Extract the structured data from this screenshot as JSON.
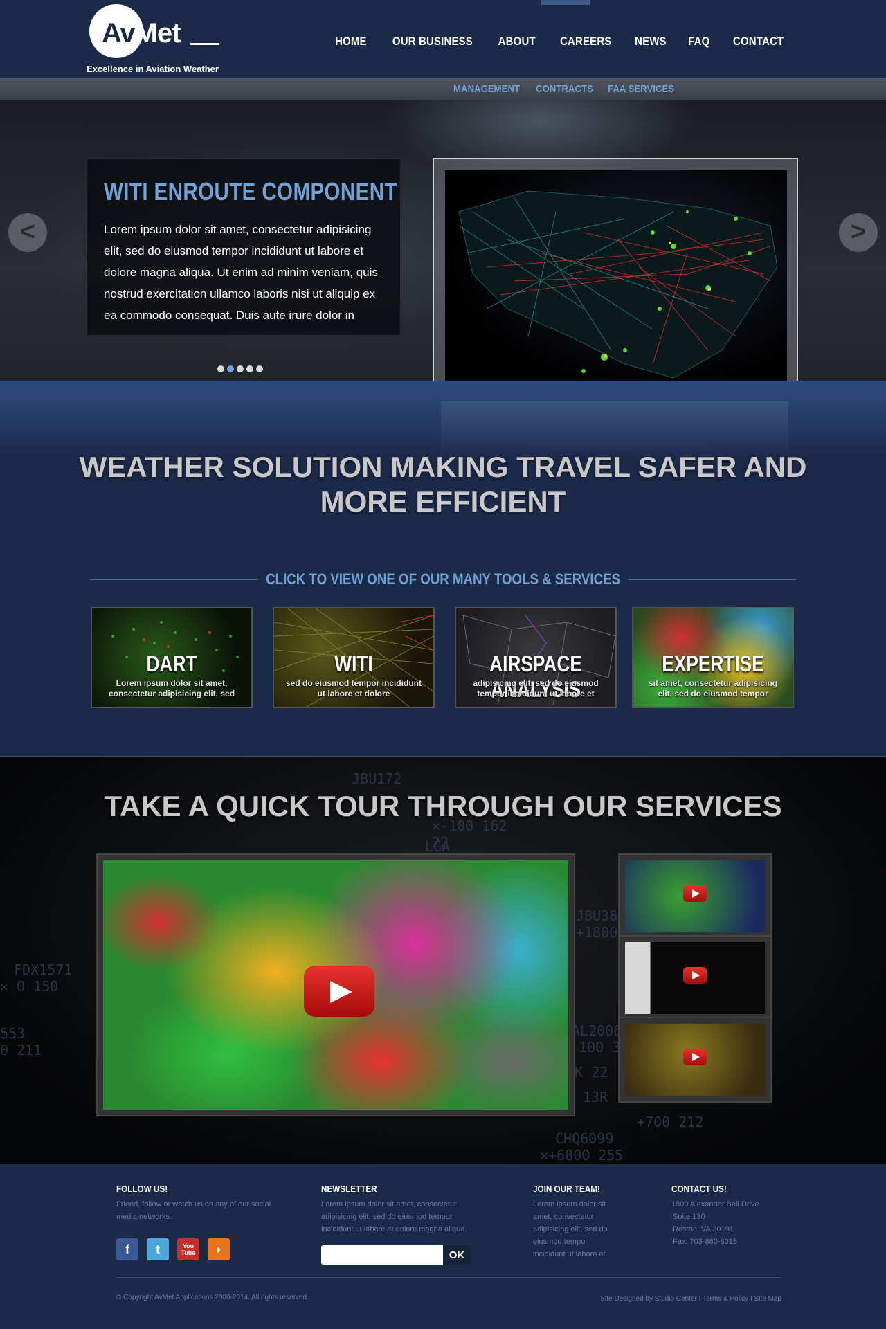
{
  "header": {
    "logo": {
      "brand_prefix": "Av",
      "brand_suffix": "Met",
      "tagline": "Excellence in Aviation Weather"
    },
    "nav": [
      {
        "label": "HOME"
      },
      {
        "label": "OUR BUSINESS"
      },
      {
        "label": "ABOUT"
      },
      {
        "label": "CAREERS"
      },
      {
        "label": "NEWS"
      },
      {
        "label": "FAQ"
      },
      {
        "label": "CONTACT"
      }
    ],
    "subnav": [
      {
        "label": "MANAGEMENT"
      },
      {
        "label": "CONTRACTS"
      },
      {
        "label": "FAA SERVICES"
      }
    ]
  },
  "hero": {
    "title": "WITI ENROUTE COMPONENT",
    "body": "Lorem ipsum dolor sit amet, consectetur adipisicing elit, sed do eiusmod tempor incididunt ut labore et dolore magna aliqua. Ut enim ad minim veniam, quis nostrud exercitation ullamco laboris nisi ut aliquip ex ea commodo consequat. Duis aute irure dolor in",
    "prev_label": "<",
    "next_label": ">",
    "slide_count": 5,
    "active_slide": 2
  },
  "headline": {
    "line1": "WEATHER SOLUTION MAKING TRAVEL SAFER AND",
    "line2": "MORE EFFICIENT"
  },
  "tools": {
    "heading": "CLICK TO VIEW ONE OF OUR MANY TOOLS & SERVICES",
    "items": [
      {
        "title": "DART",
        "desc": "Lorem ipsum dolor sit amet, consectetur adipisicing elit, sed"
      },
      {
        "title": "WITI",
        "desc": "sed do eiusmod tempor incididunt ut labore et dolore"
      },
      {
        "title": "AIRSPACE ANALYSIS",
        "desc": "adipisicing elit, sed do eiusmod tempor incididunt ut labore et"
      },
      {
        "title": "EXPERTISE",
        "desc": "sit amet, consectetur adipisicing elit, sed do eiusmod tempor"
      }
    ]
  },
  "tour": {
    "title": "TAKE A QUICK TOUR THROUGH OUR SERVICES",
    "bg_labels": [
      "JBU172",
      "✕-100 162",
      "22",
      "LGA",
      "FDX1571",
      "✕ 0 150",
      "553",
      "0 211",
      "JBU38",
      "+1800",
      "AL2006",
      "100 3",
      "13R",
      "CHQ6099",
      "✕+6800 255",
      "+700 212",
      "K 22"
    ]
  },
  "footer": {
    "follow": {
      "heading": "FOLLOW US!",
      "text": "Friend, follow or watch us on any of our social media networks."
    },
    "social": [
      {
        "name": "facebook",
        "glyph": "f",
        "color": "#3b5998"
      },
      {
        "name": "twitter",
        "glyph": "t",
        "color": "#4aa8dc"
      },
      {
        "name": "youtube",
        "glyph": "You Tube",
        "color": "#c4302b"
      },
      {
        "name": "rss",
        "glyph": "◗",
        "color": "#e8731b"
      }
    ],
    "newsletter": {
      "heading": "NEWSLETTER",
      "text": "Lorem ipsum dolor sit amet, consectetur adipisicing elit, sed do eiusmod tempor incididunt ut labore et dolore magna aliqua.",
      "placeholder": "",
      "button": "OK"
    },
    "team": {
      "heading": "JOIN OUR TEAM!",
      "text": "Lorem ipsum dolor sit amet, consectetur adipisicing elit, sed do eiusmod tempor incididunt ut labore et"
    },
    "contact": {
      "heading": "CONTACT US!",
      "line1": "1800 Alexander Bell Drive",
      "line2": "Suite 130",
      "line3": "Reston, VA 20191",
      "line4": "Fax: 703-860-8015"
    },
    "copyright": "© Copyright AvMet Applications 2000-2014. All rights reserved.",
    "links": {
      "designed": "Site Designed by Studio Center",
      "terms": "Terms & Policy",
      "sitemap": "Site Map",
      "separator": " I "
    }
  }
}
